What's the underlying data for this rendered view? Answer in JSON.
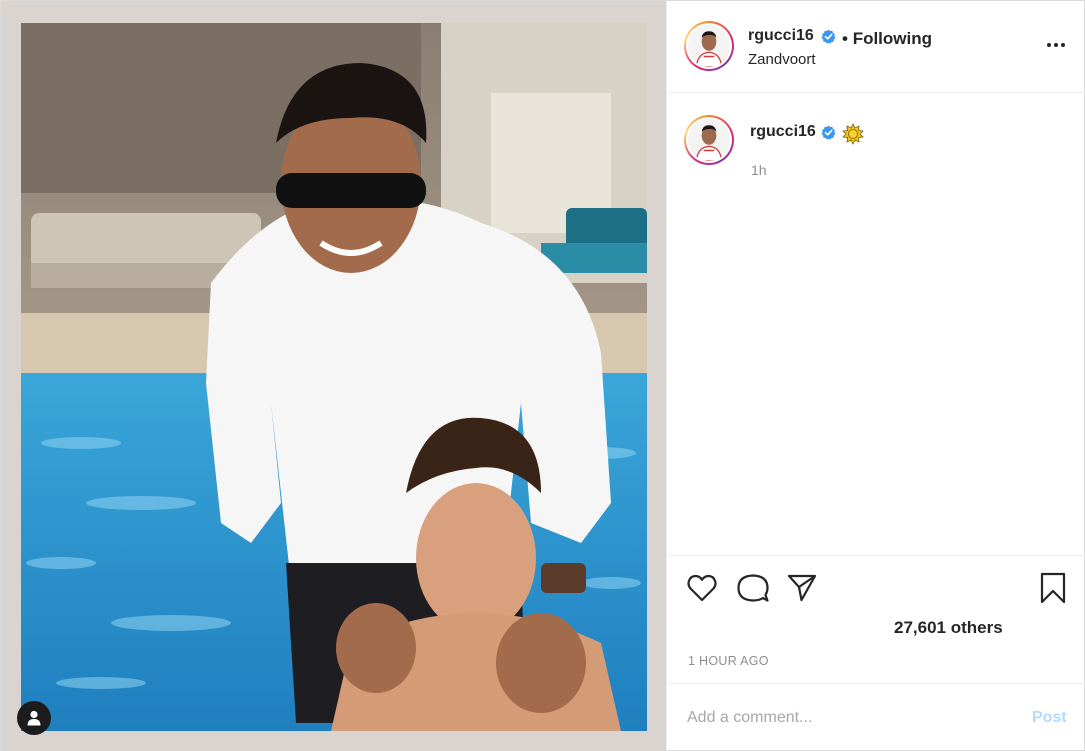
{
  "post": {
    "author": {
      "username": "rgucci16",
      "verified": true,
      "follow_separator": "•",
      "follow_status": "Following",
      "location": "Zandvoort"
    },
    "caption": {
      "username": "rgucci16",
      "emoji": "sun-emoji",
      "time": "1h"
    },
    "likes_text": "27,601 others",
    "timestamp": "1 HOUR AGO",
    "comment": {
      "placeholder": "Add a comment...",
      "post_label": "Post"
    },
    "icons": [
      "heart-icon",
      "comment-icon",
      "share-icon",
      "bookmark-icon",
      "more-icon",
      "user-tag-icon",
      "verified-badge-icon"
    ],
    "colors": {
      "verified": "#3897f0",
      "post_button_disabled": "#b3dbff",
      "secondary_text": "#8e8e8e"
    }
  }
}
